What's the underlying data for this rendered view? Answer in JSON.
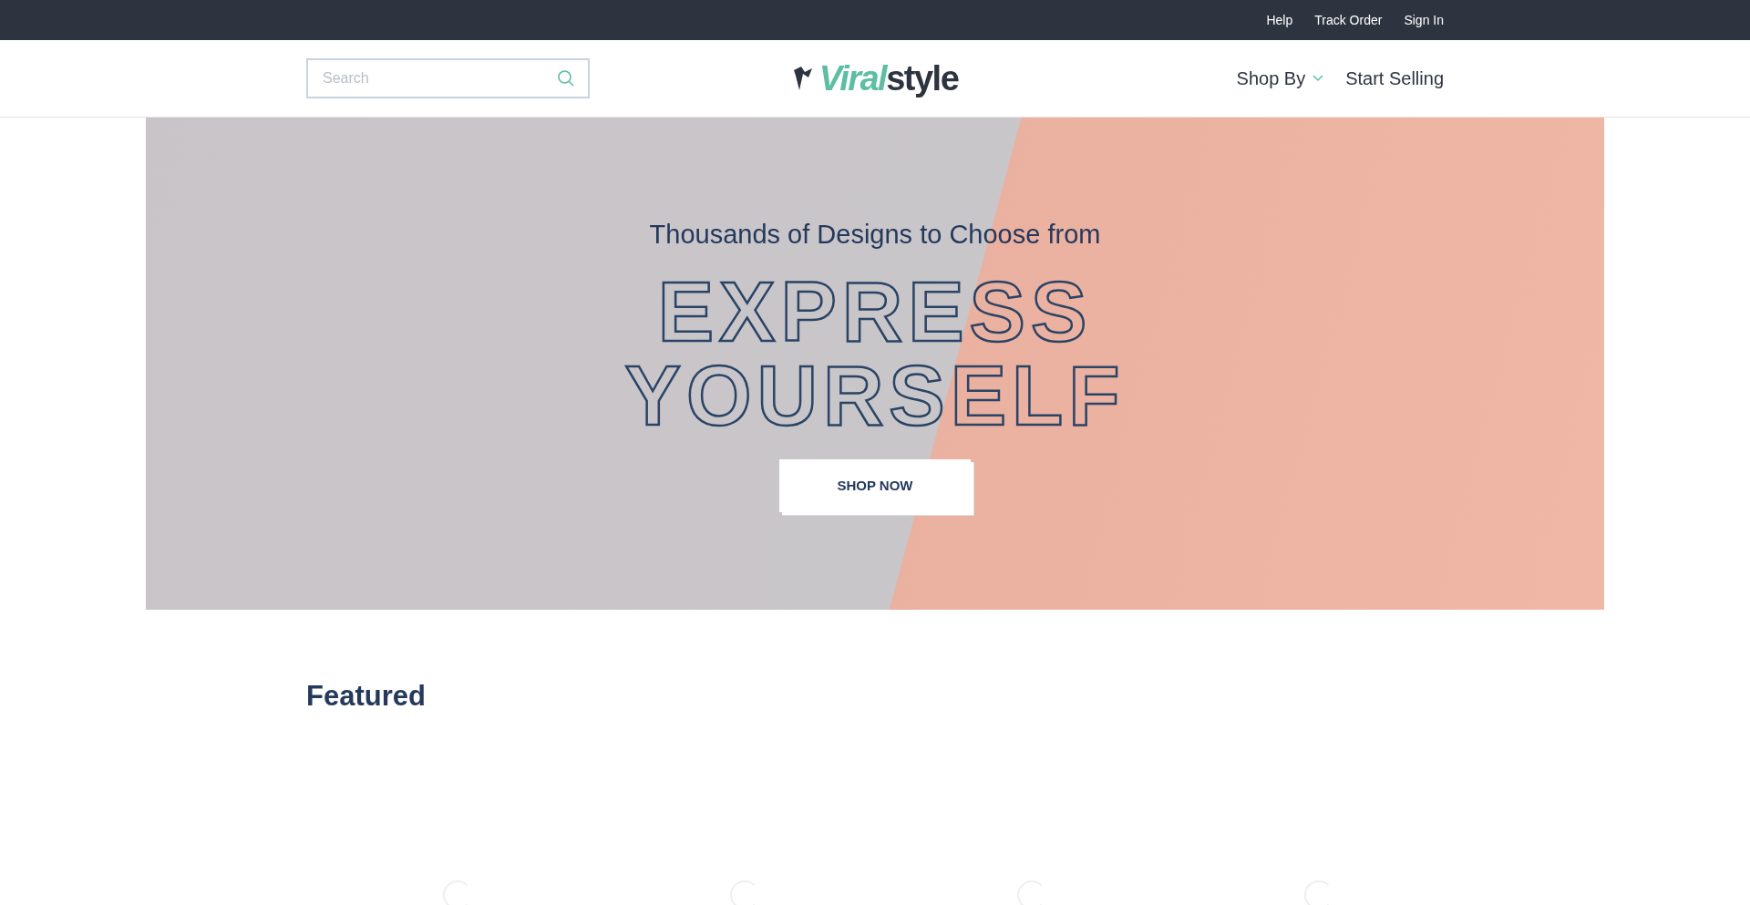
{
  "top_bar": {
    "links": [
      "Help",
      "Track Order",
      "Sign In"
    ]
  },
  "header": {
    "search": {
      "placeholder": "Search"
    },
    "logo": {
      "accent": "Viral",
      "rest": "style"
    },
    "nav": [
      {
        "label": "Shop By",
        "kind": "dropdown"
      },
      {
        "label": "Start Selling",
        "kind": "link"
      }
    ]
  },
  "hero": {
    "subtitle": "Thousands of Designs to Choose from",
    "headline_lines": [
      "EXPRESS",
      "YOURSELF"
    ],
    "button": "SHOP NOW"
  },
  "featured": {
    "title": "Featured",
    "product_cards": [
      {
        "loading": true
      },
      {
        "loading": true
      },
      {
        "loading": true
      },
      {
        "loading": true
      }
    ]
  }
}
